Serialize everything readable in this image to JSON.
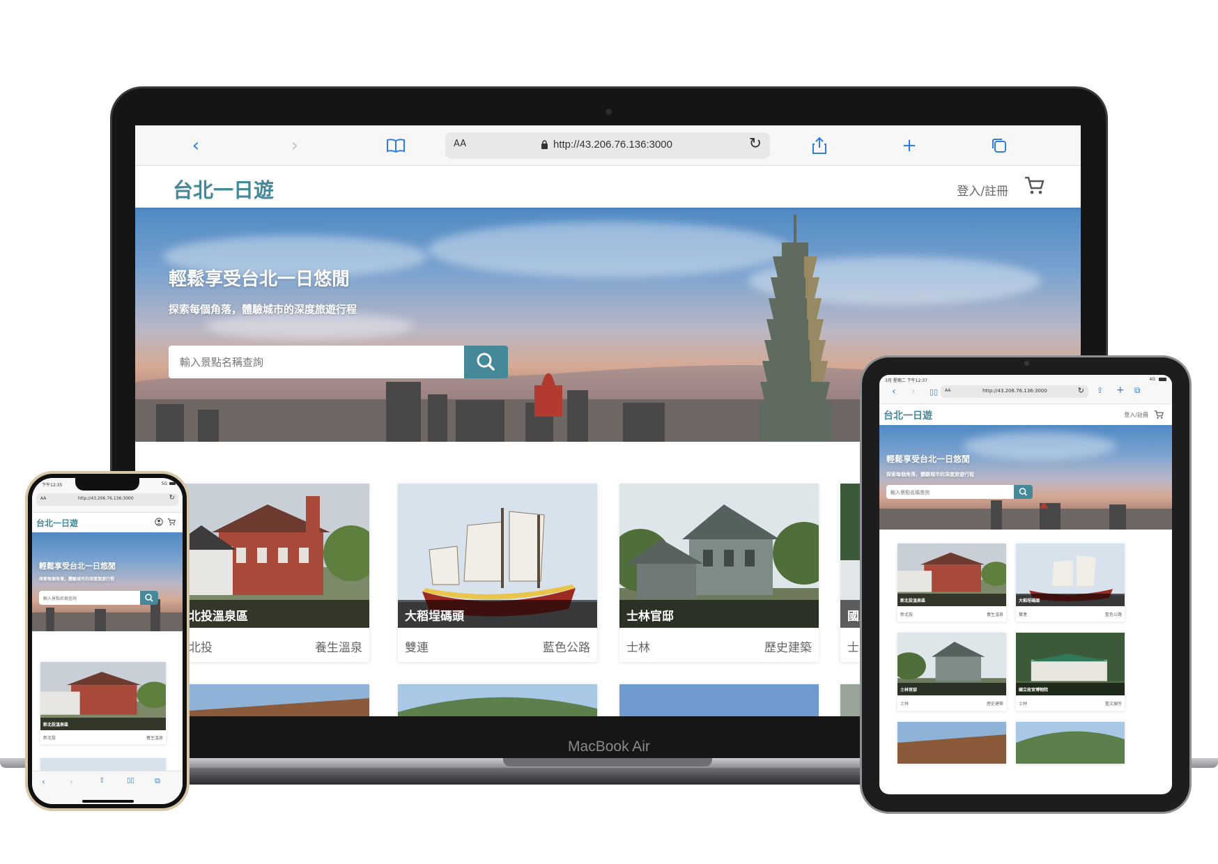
{
  "browser": {
    "url": "http://43.206.76.136:3000",
    "reader_label": "AA"
  },
  "site": {
    "logo": "台北一日遊",
    "login": "登入/註冊",
    "hero_title": "輕鬆享受台北一日悠閒",
    "hero_subtitle": "探索每個角落，體驗城市的深度旅遊行程",
    "search_placeholder": "輸入景點名稱查詢"
  },
  "attractions": [
    {
      "name": "新北投溫泉區",
      "mrt": "新北投",
      "category": "養生溫泉"
    },
    {
      "name": "大稻埕碼頭",
      "mrt": "雙連",
      "category": "藍色公路"
    },
    {
      "name": "士林官邸",
      "mrt": "士林",
      "category": "歷史建築"
    },
    {
      "name": "國立故宮博物院",
      "mrt": "士林",
      "category": "藝文展所"
    }
  ],
  "device": {
    "laptop_brand": "MacBook Air",
    "phone_time": "下午12:35",
    "phone_signal": "5G",
    "tablet_time": "3月 星期二 下午12:37",
    "tablet_signal": "4G"
  },
  "colors": {
    "brand": "#448899",
    "safari_blue": "#2f7de1"
  }
}
